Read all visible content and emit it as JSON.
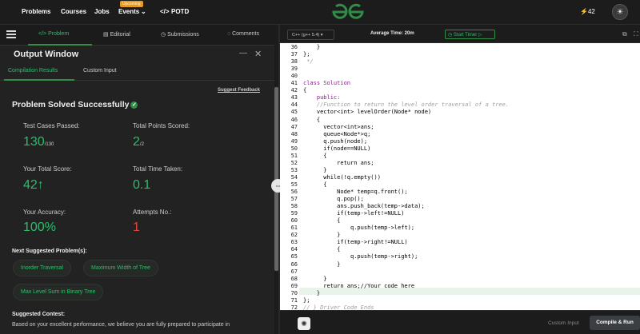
{
  "nav": {
    "links": [
      "Problems",
      "Courses",
      "Jobs",
      "Events",
      "POTD"
    ],
    "events_badge": "Upcoming",
    "events_chevron": "chevron-down-icon",
    "potd_icon": "code-icon",
    "streak": "42",
    "streak_icon": "lightning-icon",
    "logo": "GfG"
  },
  "left_tabs": [
    "Problem",
    "Editorial",
    "Submissions",
    "Comments"
  ],
  "output_window": {
    "title": "Output Window",
    "subtabs": [
      "Compilation Results",
      "Custom Input"
    ],
    "suggest_feedback": "Suggest Feedback",
    "status": "Problem Solved Successfully",
    "stats": [
      {
        "label": "Test Cases Passed:",
        "value": "130",
        "suffix": "/130"
      },
      {
        "label": "Total Points Scored:",
        "value": "2",
        "suffix": "/2"
      },
      {
        "label": "Your Total Score:",
        "value": "42",
        "suffix": "↑"
      },
      {
        "label": "Total Time Taken:",
        "value": "0.1",
        "suffix": ""
      },
      {
        "label": "Your Accuracy:",
        "value": "100%",
        "suffix": ""
      },
      {
        "label": "Attempts No.:",
        "value": "1",
        "suffix": ""
      }
    ],
    "next_heading": "Next Suggested Problem(s):",
    "chips": [
      "Inorder Traversal",
      "Maximum Width of Tree",
      "Max Level Sum in Binary Tree"
    ],
    "contest_heading": "Suggested Contest:",
    "contest_text": "Based on your excellent performance, we believe you are fully prepared to participate in"
  },
  "editor": {
    "language": "C++ (g++ 5.4)",
    "average_time": "Average Time: 20m",
    "start_timer": "Start Timer",
    "code_lines": [
      {
        "n": "36",
        "t": "    }",
        "c": ""
      },
      {
        "n": "37",
        "t": "};",
        "c": ""
      },
      {
        "n": "38",
        "t": " */",
        "c": "comment"
      },
      {
        "n": "39",
        "t": "",
        "c": ""
      },
      {
        "n": "40",
        "t": "",
        "c": ""
      },
      {
        "n": "41",
        "t": "class Solution",
        "c": "kw"
      },
      {
        "n": "42",
        "t": "{",
        "c": ""
      },
      {
        "n": "43",
        "t": "    public:",
        "c": "kw"
      },
      {
        "n": "44",
        "t": "    //Function to return the level order traversal of a tree.",
        "c": "comment"
      },
      {
        "n": "45",
        "t": "    vector<int> levelOrder(Node* node)",
        "c": ""
      },
      {
        "n": "46",
        "t": "    {",
        "c": ""
      },
      {
        "n": "47",
        "t": "      vector<int>ans;",
        "c": ""
      },
      {
        "n": "48",
        "t": "      queue<Node*>q;",
        "c": ""
      },
      {
        "n": "49",
        "t": "      q.push(node);",
        "c": ""
      },
      {
        "n": "50",
        "t": "      if(node==NULL)",
        "c": ""
      },
      {
        "n": "51",
        "t": "      {",
        "c": ""
      },
      {
        "n": "52",
        "t": "          return ans;",
        "c": ""
      },
      {
        "n": "53",
        "t": "      }",
        "c": ""
      },
      {
        "n": "54",
        "t": "      while(!q.empty())",
        "c": ""
      },
      {
        "n": "55",
        "t": "      {",
        "c": ""
      },
      {
        "n": "56",
        "t": "          Node* temp=q.front();",
        "c": ""
      },
      {
        "n": "57",
        "t": "          q.pop();",
        "c": ""
      },
      {
        "n": "58",
        "t": "          ans.push_back(temp->data);",
        "c": ""
      },
      {
        "n": "59",
        "t": "          if(temp->left!=NULL)",
        "c": ""
      },
      {
        "n": "60",
        "t": "          {",
        "c": ""
      },
      {
        "n": "61",
        "t": "              q.push(temp->left);",
        "c": ""
      },
      {
        "n": "62",
        "t": "          }",
        "c": ""
      },
      {
        "n": "63",
        "t": "          if(temp->right!=NULL)",
        "c": ""
      },
      {
        "n": "64",
        "t": "          {",
        "c": ""
      },
      {
        "n": "65",
        "t": "              q.push(temp->right);",
        "c": ""
      },
      {
        "n": "66",
        "t": "          }",
        "c": ""
      },
      {
        "n": "67",
        "t": "",
        "c": ""
      },
      {
        "n": "68",
        "t": "      }",
        "c": ""
      },
      {
        "n": "69",
        "t": "      return ans;//Your code here",
        "c": ""
      },
      {
        "n": "70",
        "t": "    }",
        "c": ""
      },
      {
        "n": "71",
        "t": "};",
        "c": ""
      },
      {
        "n": "72",
        "t": "// } Driver Code Ends",
        "c": "comment"
      }
    ],
    "custom_input": "Custom Input",
    "compile_run": "Compile & Run"
  },
  "colors": {
    "accent": "#2f8d46",
    "green_text": "#2bbf6a",
    "red_text": "#e0463a"
  }
}
